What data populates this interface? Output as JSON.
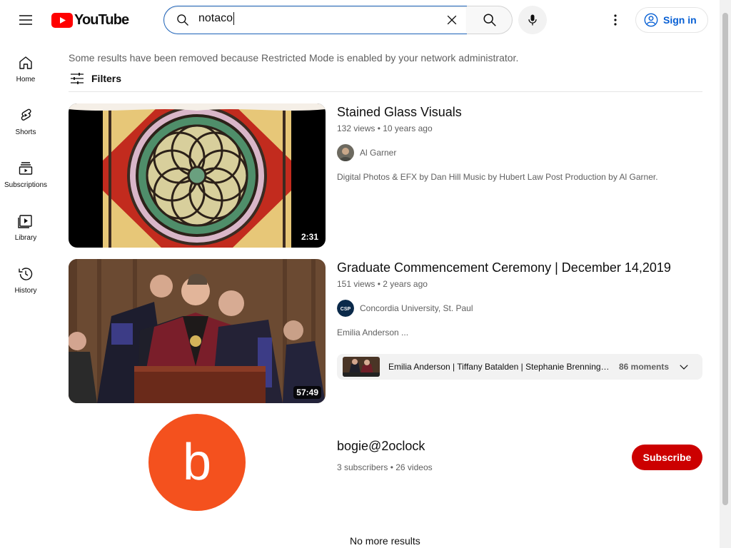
{
  "header": {
    "logo_text": "YouTube",
    "search_value": "notaco",
    "signin_label": "Sign in"
  },
  "sidebar": {
    "items": [
      {
        "label": "Home",
        "icon": "home-icon"
      },
      {
        "label": "Shorts",
        "icon": "shorts-icon"
      },
      {
        "label": "Subscriptions",
        "icon": "subscriptions-icon"
      },
      {
        "label": "Library",
        "icon": "library-icon"
      },
      {
        "label": "History",
        "icon": "history-icon"
      }
    ]
  },
  "results": {
    "notice": "Some results have been removed because Restricted Mode is enabled by your network administrator.",
    "filters_label": "Filters",
    "videos": [
      {
        "title": "Stained Glass Visuals",
        "views": "132 views",
        "age": "10 years ago",
        "channel": "Al Garner",
        "description": "Digital Photos & EFX by Dan Hill Music by Hubert Law Post Production by Al Garner.",
        "duration": "2:31"
      },
      {
        "title": "Graduate Commencement Ceremony | December 14,2019",
        "views": "151 views",
        "age": "2 years ago",
        "channel": "Concordia University, St. Paul",
        "channel_badge": "CSP",
        "description": "Emilia Anderson ...",
        "duration": "57:49",
        "moments_text": "Emilia Anderson | Tiffany Batalden | Stephanie Brenning | Hannah Burt | Kenneth Carlson",
        "moments_count": "86 moments"
      }
    ],
    "channel": {
      "initial": "b",
      "name": "bogie@2oclock",
      "subscribers": "3 subscribers",
      "videos": "26 videos",
      "subscribe_label": "Subscribe",
      "avatar_color": "#f4511e"
    },
    "end_text": "No more results"
  },
  "colors": {
    "brand_red": "#ff0000",
    "subscribe_red": "#cc0000",
    "link_blue": "#065fd4"
  }
}
